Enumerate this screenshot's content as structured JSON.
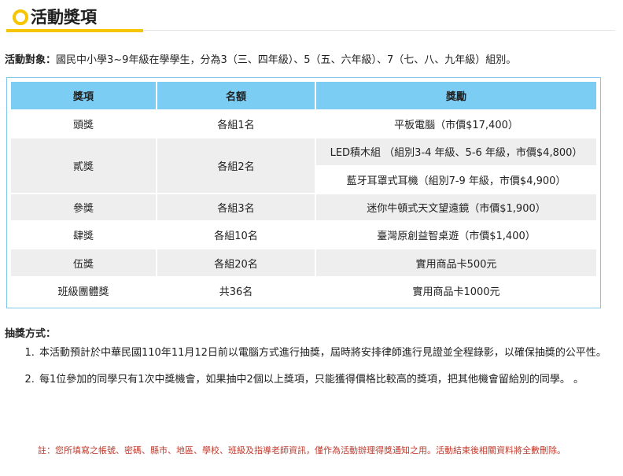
{
  "header": {
    "title": "活動獎項"
  },
  "audience": {
    "label": "活動對象：",
    "text": "國民中小學3~9年級在學學生，分為3（三、四年級）、5（五、六年級）、7（七、八、九年級）組別。"
  },
  "table": {
    "headers": [
      "獎項",
      "名額",
      "獎勵"
    ],
    "rows": {
      "r1": {
        "prize": "頭獎",
        "quota": "各組1名",
        "reward": "平板電腦（市價$17,400）"
      },
      "r2": {
        "prize": "貳獎",
        "quota": "各組2名",
        "reward_a": "LED積木組 （組別3-4 年級、5-6 年級，市價$4,800）",
        "reward_b": "藍牙耳罩式耳機（組別7-9 年級，市價$4,900）"
      },
      "r3": {
        "prize": "參獎",
        "quota": "各組3名",
        "reward": "迷你牛頓式天文望遠鏡（市價$1,900）"
      },
      "r4": {
        "prize": "肆獎",
        "quota": "各組10名",
        "reward": "臺灣原創益智桌遊（市價$1,400）"
      },
      "r5": {
        "prize": "伍獎",
        "quota": "各組20名",
        "reward": "實用商品卡500元"
      },
      "r6": {
        "prize": "班級團體獎",
        "quota": "共36名",
        "reward": "實用商品卡1000元"
      }
    }
  },
  "method": {
    "title": "抽獎方式：",
    "items": [
      "本活動預計於中華民國110年11月12日前以電腦方式進行抽獎，屆時將安排律師進行見證並全程錄影，以確保抽獎的公平性。",
      "每1位參加的同學只有1次中獎機會，如果抽中2個以上獎項，只能獲得價格比較高的獎項，把其他機會留給別的同學。 。"
    ]
  },
  "note": "註：您所填寫之帳號、密碼、縣市、地區、學校、班級及指導老師資訊，僅作為活動辦理得獎通知之用。活動結束後相關資料將全數刪除。",
  "colors": {
    "accent": "#f6c500",
    "table_header": "#7bcdf3",
    "table_border": "#7fc8ec",
    "note": "#c0392b"
  }
}
